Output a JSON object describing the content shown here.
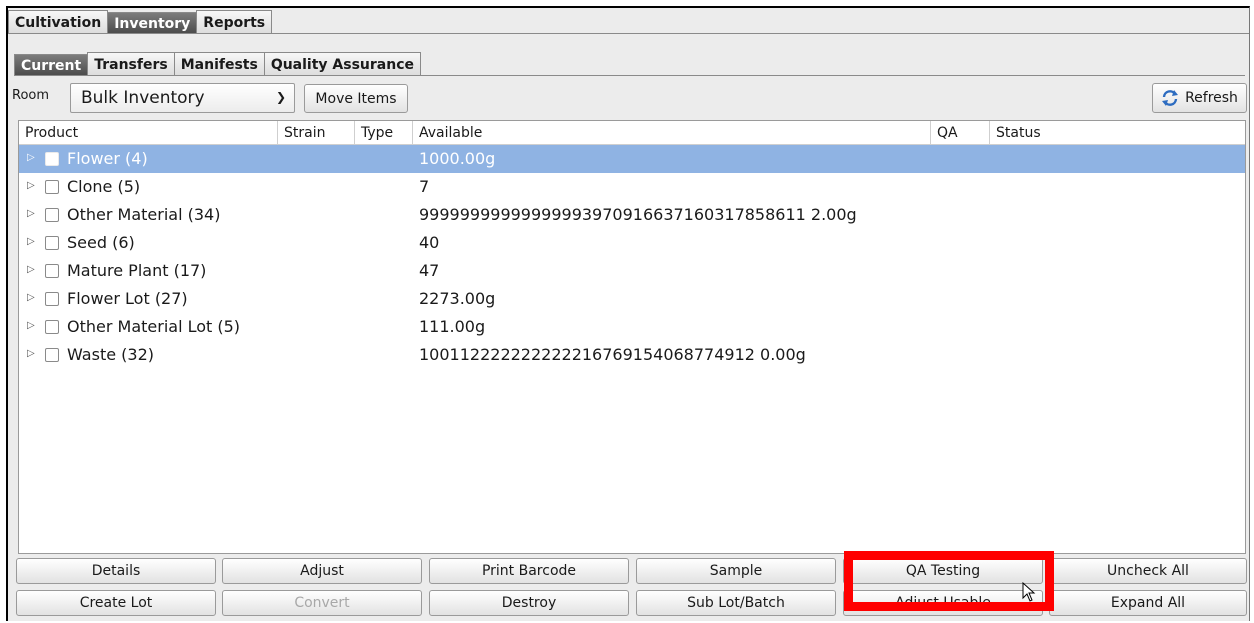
{
  "main_tabs": [
    "Cultivation",
    "Inventory",
    "Reports"
  ],
  "main_tab_active": "Inventory",
  "sub_tabs": [
    "Current",
    "Transfers",
    "Manifests",
    "Quality Assurance"
  ],
  "sub_tab_active": "Current",
  "toolbar": {
    "room_label": "Room",
    "room_value": "Bulk Inventory",
    "move_label": "Move Items",
    "refresh_label": "Refresh"
  },
  "grid": {
    "columns": [
      "Product",
      "Strain",
      "Type",
      "Available",
      "QA",
      "Status"
    ],
    "rows": [
      {
        "product": "Flower (4)",
        "available": "1000.00g",
        "selected": true
      },
      {
        "product": "Clone (5)",
        "available": "7"
      },
      {
        "product": "Other Material (34)",
        "available": "99999999999999993970916637160317858611 2.00g"
      },
      {
        "product": "Seed (6)",
        "available": "40"
      },
      {
        "product": "Mature Plant (17)",
        "available": "47"
      },
      {
        "product": "Flower Lot (27)",
        "available": "2273.00g"
      },
      {
        "product": "Other Material Lot (5)",
        "available": "111.00g"
      },
      {
        "product": "Waste (32)",
        "available": "100112222222222216769154068774912 0.00g"
      }
    ]
  },
  "buttons_row1": [
    "Details",
    "Adjust",
    "Print Barcode",
    "Sample",
    "QA Testing",
    "Uncheck All"
  ],
  "buttons_row2": [
    "Create Lot",
    "Convert",
    "Destroy",
    "Sub Lot/Batch",
    "Adjust Usable",
    "Expand All"
  ],
  "disabled_buttons": [
    "Convert"
  ],
  "colors": {
    "selection": "#8fb3e3",
    "highlight_box": "#ff0000",
    "active_tab": "#4a4a4a"
  }
}
